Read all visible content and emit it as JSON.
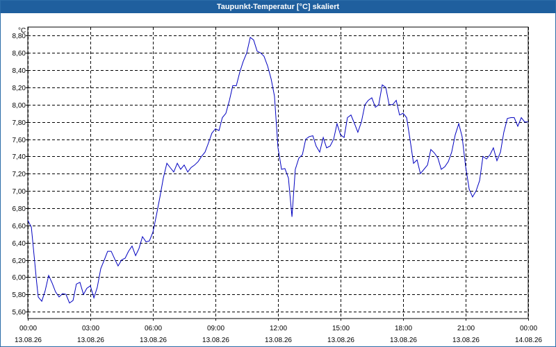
{
  "window": {
    "title": "Taupunkt-Temperatur [°C] skaliert"
  },
  "chart_data": {
    "type": "line",
    "title": "Taupunkt-Temperatur [°C] skaliert",
    "ylabel": "°C",
    "xlabel": "",
    "xlim": [
      0,
      24
    ],
    "ylim": [
      5.52,
      8.9
    ],
    "grid": true,
    "line_color": "#0000c0",
    "y_ticks": [
      "5,60",
      "5,80",
      "6,00",
      "6,20",
      "6,40",
      "6,60",
      "6,80",
      "7,00",
      "7,20",
      "7,40",
      "7,60",
      "7,80",
      "8,00",
      "8,20",
      "8,40",
      "8,60",
      "8,80"
    ],
    "y_tick_values": [
      5.6,
      5.8,
      6.0,
      6.2,
      6.4,
      6.6,
      6.8,
      7.0,
      7.2,
      7.4,
      7.6,
      7.8,
      8.0,
      8.2,
      8.4,
      8.6,
      8.8
    ],
    "x_ticks": [
      {
        "time": "00:00",
        "date": "13.08.26",
        "hour": 0
      },
      {
        "time": "03:00",
        "date": "13.08.26",
        "hour": 3
      },
      {
        "time": "06:00",
        "date": "13.08.26",
        "hour": 6
      },
      {
        "time": "09:00",
        "date": "13.08.26",
        "hour": 9
      },
      {
        "time": "12:00",
        "date": "13.08.26",
        "hour": 12
      },
      {
        "time": "15:00",
        "date": "13.08.26",
        "hour": 15
      },
      {
        "time": "18:00",
        "date": "13.08.26",
        "hour": 18
      },
      {
        "time": "21:00",
        "date": "13.08.26",
        "hour": 21
      },
      {
        "time": "00:00",
        "date": "14.08.26",
        "hour": 24
      }
    ],
    "series": [
      {
        "x": [
          0.0,
          0.17,
          0.33,
          0.42,
          0.5,
          0.67,
          0.83,
          1.0,
          1.17,
          1.33,
          1.5,
          1.67,
          1.83,
          2.0,
          2.17,
          2.33,
          2.5,
          2.67,
          2.83,
          3.0,
          3.17,
          3.33,
          3.5,
          3.67,
          3.83,
          4.0,
          4.17,
          4.33,
          4.5,
          4.67,
          4.83,
          5.0,
          5.17,
          5.33,
          5.5,
          5.67,
          5.83,
          6.0,
          6.17,
          6.33,
          6.5,
          6.67,
          6.83,
          7.0,
          7.17,
          7.33,
          7.5,
          7.67,
          7.83,
          8.0,
          8.17,
          8.33,
          8.5,
          8.67,
          8.83,
          9.0,
          9.17,
          9.33,
          9.5,
          9.67,
          9.83,
          10.0,
          10.17,
          10.33,
          10.5,
          10.67,
          10.83,
          11.0,
          11.17,
          11.33,
          11.5,
          11.67,
          11.83,
          12.0,
          12.17,
          12.33,
          12.5,
          12.67,
          12.83,
          13.0,
          13.17,
          13.33,
          13.5,
          13.67,
          13.83,
          14.0,
          14.17,
          14.33,
          14.5,
          14.67,
          14.83,
          15.0,
          15.17,
          15.33,
          15.5,
          15.67,
          15.83,
          16.0,
          16.17,
          16.33,
          16.5,
          16.67,
          16.83,
          17.0,
          17.17,
          17.33,
          17.5,
          17.67,
          17.83,
          18.0,
          18.17,
          18.33,
          18.5,
          18.67,
          18.83,
          19.0,
          19.17,
          19.33,
          19.5,
          19.67,
          19.83,
          20.0,
          20.17,
          20.33,
          20.5,
          20.67,
          20.83,
          21.0,
          21.17,
          21.33,
          21.5,
          21.67,
          21.83,
          22.0,
          22.17,
          22.33,
          22.5,
          22.67,
          22.83,
          23.0,
          23.17,
          23.33,
          23.5,
          23.67,
          23.83,
          24.0
        ],
        "y": [
          6.66,
          6.58,
          6.18,
          5.95,
          5.77,
          5.72,
          5.84,
          6.02,
          5.93,
          5.83,
          5.77,
          5.81,
          5.8,
          5.7,
          5.73,
          5.92,
          5.94,
          5.8,
          5.87,
          5.9,
          5.76,
          5.88,
          6.1,
          6.2,
          6.3,
          6.3,
          6.21,
          6.13,
          6.2,
          6.22,
          6.3,
          6.36,
          6.25,
          6.33,
          6.47,
          6.41,
          6.42,
          6.52,
          6.72,
          6.92,
          7.15,
          7.32,
          7.27,
          7.22,
          7.32,
          7.25,
          7.3,
          7.22,
          7.27,
          7.3,
          7.34,
          7.4,
          7.45,
          7.56,
          7.67,
          7.72,
          7.7,
          7.85,
          7.9,
          8.05,
          8.22,
          8.22,
          8.38,
          8.5,
          8.6,
          8.78,
          8.75,
          8.62,
          8.6,
          8.56,
          8.45,
          8.3,
          8.1,
          7.5,
          7.25,
          7.26,
          7.15,
          6.7,
          7.25,
          7.38,
          7.42,
          7.6,
          7.63,
          7.64,
          7.52,
          7.45,
          7.62,
          7.5,
          7.52,
          7.6,
          7.78,
          7.65,
          7.62,
          7.85,
          7.88,
          7.78,
          7.68,
          7.8,
          8.0,
          8.05,
          8.08,
          7.97,
          8.0,
          8.23,
          8.2,
          8.0,
          8.0,
          8.05,
          7.88,
          7.9,
          7.85,
          7.6,
          7.32,
          7.36,
          7.2,
          7.25,
          7.3,
          7.48,
          7.44,
          7.38,
          7.25,
          7.28,
          7.34,
          7.45,
          7.65,
          7.78,
          7.63,
          7.28,
          7.02,
          6.93,
          7.0,
          7.12,
          7.4,
          7.37,
          7.42,
          7.5,
          7.35,
          7.45,
          7.68,
          7.84,
          7.85,
          7.85,
          7.75,
          7.85,
          7.8,
          7.8
        ]
      }
    ]
  }
}
